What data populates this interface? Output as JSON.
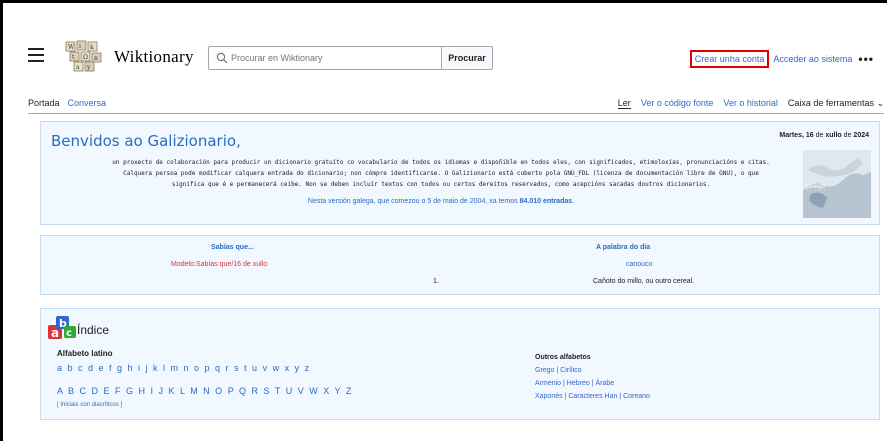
{
  "header": {
    "logo_text": "Wiktionary",
    "search_placeholder": "Procurar en Wiktionary",
    "search_button": "Procurar",
    "create_account": "Crear unha conta",
    "login": "Acceder ao sistema",
    "more": "•••"
  },
  "tabs": {
    "left": [
      "Portada",
      "Conversa"
    ],
    "right": [
      "Ler",
      "Ver o código fonte",
      "Ver o historial",
      "Caixa de ferramentas ⌄"
    ]
  },
  "welcome": {
    "title": "Benvidos ao Galizionario,",
    "date_day": "Martes,",
    "date_num": "16",
    "date_de1": "de",
    "date_month": "xullo",
    "date_de2": "de",
    "date_year": "2024",
    "desc_line1": "un proxecto de colaboración para producir un dicionario gratuíto co vocabulario de todos os idiomas e dispoñible en todos eles, con significados, etimoloxías, pronunciacións e citas.",
    "desc_line2": "Calquera persoa pode modificar calquera entrada do dicionario; non cómpre identificarse. O Galizionario está cuberto pola GNU_FDL (licenza de documentación libre de GNU), o que",
    "desc_line3": "significa que é e permanecerá ceibe. Non se deben incluír textos con todos ou certos dereitos reservados, como acepcións sacadas doutros dicionarios.",
    "sub_prefix": "Nesta versión galega, que comezou o 5 de maio de 2004, xa temos",
    "sub_count": "84.010 entradas",
    "sub_suffix": ".",
    "map_label": "galego"
  },
  "didyouknow": {
    "title": "Sabías que...",
    "link": "Modelo:Sabías que/16 de xullo",
    "number": "1."
  },
  "wotd": {
    "title": "A palabra do día",
    "word": "canouco",
    "definition": "Cañoto do millo, ou outro cereal."
  },
  "index": {
    "title": "Índice",
    "latin_label": "Alfabeto latino",
    "lowercase": "a b c d e f g h i j k l m n o p q r s t u v w x y z",
    "uppercase": "A B C D E F G H I J K L M N O P Q R S T U V W X Y Z",
    "diacritics": "[ Iniciais con diacríticos ]",
    "other_label": "Outros alfabetos",
    "other_line1": "Grego | Cirílico",
    "other_line2": "Armenio | Hebreo | Árabe",
    "other_line3": "Xaponés | Caracteres Han | Coreano"
  },
  "colors": {
    "link": "#3366cc",
    "heading_blue": "#2a6cbf",
    "red_link": "#dd3333",
    "box_bg": "#f2f8ff",
    "box_border": "#c6dcf5",
    "highlight": "#e00000"
  }
}
